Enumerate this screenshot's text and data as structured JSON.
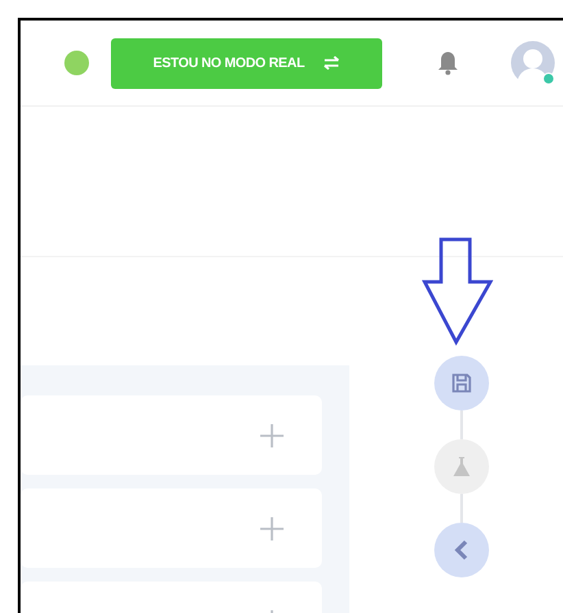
{
  "header": {
    "status": {
      "online": true
    },
    "mode_button": {
      "label": "ESTOU NO MODO REAL"
    },
    "avatar": {
      "online": true
    }
  },
  "accordion_rows": [
    {
      "expanded": false
    },
    {
      "expanded": false
    },
    {
      "expanded": false
    }
  ],
  "step_rail": [
    {
      "kind": "save",
      "disabled": false
    },
    {
      "kind": "test",
      "disabled": true
    },
    {
      "kind": "back",
      "disabled": false
    }
  ]
}
